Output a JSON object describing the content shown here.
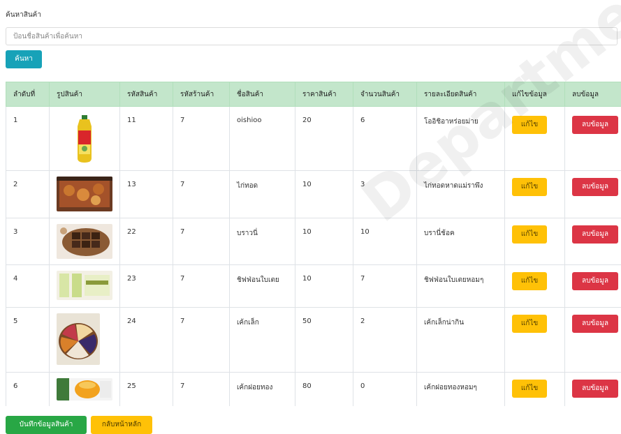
{
  "search": {
    "label": "ค้นหาสินค้า",
    "placeholder": "ป้อนชื่อสินค้าเพื่อค้นหา",
    "button_label": "ค้นหา"
  },
  "table": {
    "headers": [
      "ลำดับที่",
      "รูปสินค้า",
      "รหัสสินค้า",
      "รหัสร้านค้า",
      "ชื่อสินค้า",
      "ราคาสินค้า",
      "จำนวนสินค้า",
      "รายละเอียดสินค้า",
      "แก้ไขข้อมูล",
      "ลบข้อมูล"
    ],
    "rows": [
      {
        "no": "1",
        "image": "bottle-drink-photo",
        "product_id": "11",
        "shop_id": "7",
        "name": "oishioo",
        "price": "20",
        "qty": "6",
        "detail": "โออิชิอาหร่อยม่าย",
        "edit": "แก้ไข",
        "delete": "ลบข้อมูล"
      },
      {
        "no": "2",
        "image": "fried-chicken-photo",
        "product_id": "13",
        "shop_id": "7",
        "name": "ไก่ทอด",
        "price": "10",
        "qty": "3",
        "detail": "ไก่ทอดหาดแม่ราพึง",
        "edit": "แก้ไข",
        "delete": "ลบข้อมูล"
      },
      {
        "no": "3",
        "image": "brownie-photo",
        "product_id": "22",
        "shop_id": "7",
        "name": "บราวนี่",
        "price": "10",
        "qty": "10",
        "detail": "บรานี่ช้อค",
        "edit": "แก้ไข",
        "delete": "ลบข้อมูล"
      },
      {
        "no": "4",
        "image": "chiffon-cake-photo",
        "product_id": "23",
        "shop_id": "7",
        "name": "ชิฟฟ่อนใบเตย",
        "price": "10",
        "qty": "7",
        "detail": "ชิฟฟ่อนใบเตยหอมๆ",
        "edit": "แก้ไข",
        "delete": "ลบข้อมูล"
      },
      {
        "no": "5",
        "image": "small-cakes-photo",
        "product_id": "24",
        "shop_id": "7",
        "name": "เค้กเล็ก",
        "price": "50",
        "qty": "2",
        "detail": "เค้กเล็กน่ากิน",
        "edit": "แก้ไข",
        "delete": "ลบข้อมูล"
      },
      {
        "no": "6",
        "image": "foi-thong-cake-photo",
        "product_id": "25",
        "shop_id": "7",
        "name": "เค้กฝอยทอง",
        "price": "80",
        "qty": "0",
        "detail": "เค้กฝอยทองหอมๆ",
        "edit": "แก้ไข",
        "delete": "ลบข้อมูล"
      }
    ]
  },
  "footer": {
    "save_label": "บันทึกข้อมูลสินค้า",
    "home_label": "กลับหน้าหลัก"
  },
  "colors": {
    "header_bg": "#c3e6cb",
    "search_button": "#17a2b8",
    "edit_button": "#ffc107",
    "delete_button": "#dc3545",
    "save_button": "#28a745",
    "home_button": "#ffc107"
  },
  "watermark": "Department"
}
